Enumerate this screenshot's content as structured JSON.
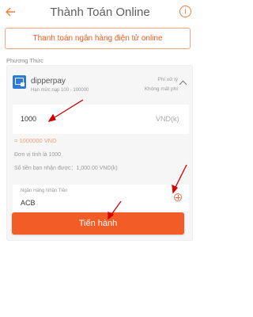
{
  "header": {
    "title": "Thành Toán Online",
    "back_icon": "arrow-left-icon",
    "info_icon": "info-icon",
    "info_glyph": "i"
  },
  "banner": {
    "text": "Thanh toán ngân hàng điện tử online"
  },
  "method": {
    "label": "Phương Thức",
    "provider": {
      "name": "dipperpay",
      "limit": "Hạn mức nạp 100 - 100000",
      "fee_label": "Phí xử lý",
      "fee_value": "Không mất phí"
    }
  },
  "amount": {
    "value": "1000",
    "unit": "VND(k)",
    "converted": "= 1000000 VND",
    "unit_note": "Đơn vị tính là 1000",
    "receive_note": "Số tiền bạn nhận được：1,000.00 VND(k)"
  },
  "bank": {
    "label": "Ngân Hàng Nhận Tiền",
    "value": "ACB"
  },
  "submit": {
    "label": "Tiến hành"
  },
  "colors": {
    "accent": "#f25c27",
    "annotation": "#d40000",
    "provider_icon": "#2f7bd4"
  }
}
